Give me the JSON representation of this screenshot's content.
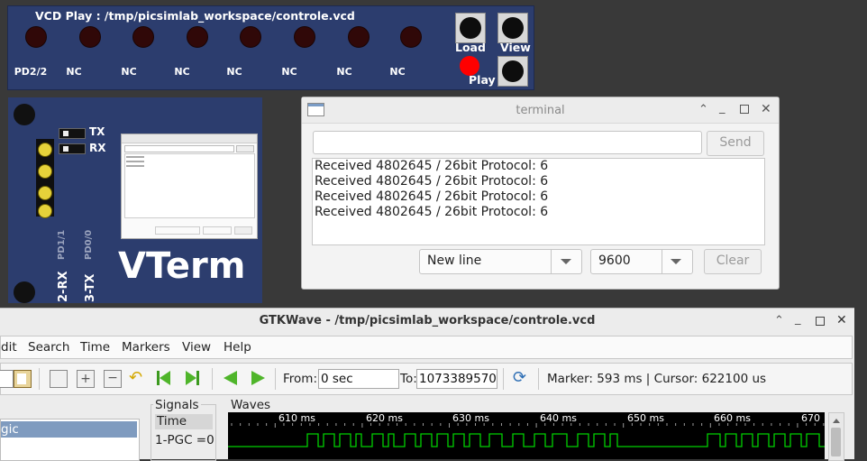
{
  "vcd_panel": {
    "title": "VCD Play : /tmp/picsimlab_workspace/controle.vcd",
    "channels": [
      "PD2/2",
      "NC",
      "NC",
      "NC",
      "NC",
      "NC",
      "NC",
      "NC"
    ],
    "load_label": "Load",
    "view_label": "View",
    "play_label": "Play",
    "play_led_color": "#ff0000"
  },
  "vterm_panel": {
    "tx_label": "TX",
    "rx_label": "RX",
    "pin_rx_num": "PD1/1",
    "pin_rx_name": "2-RX",
    "pin_tx_num": "PD0/0",
    "pin_tx_name": "3-TX",
    "brand": "VTerm"
  },
  "terminal": {
    "title": "terminal",
    "input_value": "",
    "send_label": "Send",
    "output_lines": [
      "Received 4802645 / 26bit Protocol: 6",
      "Received 4802645 / 26bit Protocol: 6",
      "Received 4802645 / 26bit Protocol: 6",
      "Received 4802645 / 26bit Protocol: 6"
    ],
    "line_ending": "New line",
    "baud": "9600",
    "clear_label": "Clear"
  },
  "gtkwave": {
    "title": "GTKWave - /tmp/picsimlab_workspace/controle.vcd",
    "menu": [
      "dit",
      "Search",
      "Time",
      "Markers",
      "View",
      "Help"
    ],
    "from_label": "From:",
    "from_value": "0 sec",
    "to_label": "To:",
    "to_value": "1073389570",
    "status": "Marker: 593 ms  |  Cursor: 622100 us",
    "left_item": "gic",
    "signals_label": "Signals",
    "signal_time": "Time",
    "signal_pgc": "1-PGC =0",
    "waves_label": "Waves",
    "ticks": [
      "610 ms",
      "620 ms",
      "630 ms",
      "640 ms",
      "650 ms",
      "660 ms",
      "670"
    ],
    "wave_color": "#00d000"
  }
}
